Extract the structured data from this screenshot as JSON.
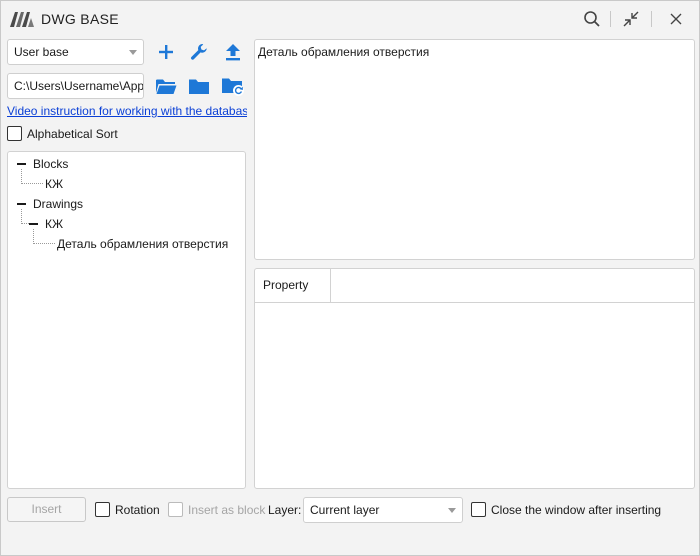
{
  "window": {
    "title": "DWG BASE"
  },
  "toolbar": {
    "base_select": "User base",
    "path_value": "C:\\Users\\Username\\AppData",
    "video_link": "Video instruction for working with the database",
    "alpha_sort_label": "Alphabetical Sort"
  },
  "tree": {
    "blocks": {
      "label": "Blocks",
      "child": "КЖ"
    },
    "drawings": {
      "label": "Drawings",
      "child": "КЖ",
      "grandchild": "Деталь обрамления отверстия"
    }
  },
  "preview": {
    "caption": "Деталь обрамления отверстия"
  },
  "properties": {
    "column_property": "Property",
    "column_value": ""
  },
  "bottom": {
    "insert_label": "Insert",
    "rotation_label": "Rotation",
    "insert_block_label": "Insert as block",
    "layer_label": "Layer:",
    "layer_select": "Current layer",
    "close_after_label": "Close the window after inserting"
  },
  "colors": {
    "accent": "#1e78d7",
    "link": "#0a3fd6"
  },
  "icons": [
    "logo-icon",
    "search-icon",
    "collapse-icon",
    "close-icon",
    "add-icon",
    "wrench-icon",
    "upload-icon",
    "folder-open-icon",
    "folder-icon",
    "folder-refresh-icon"
  ]
}
